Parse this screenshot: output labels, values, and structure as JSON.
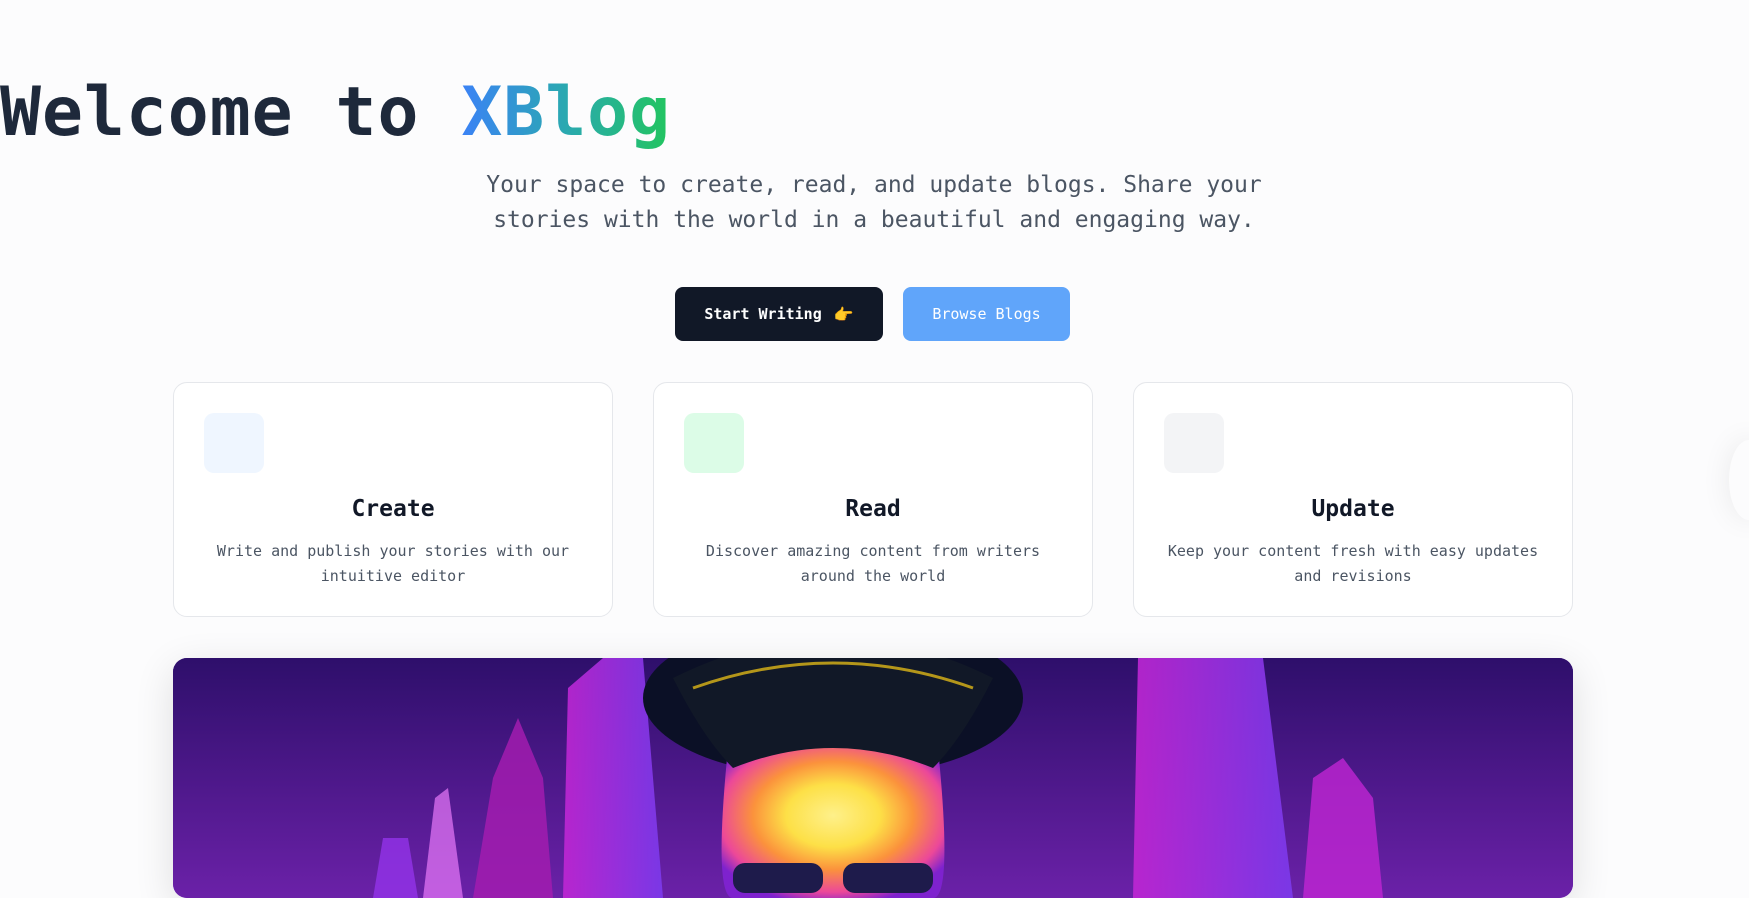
{
  "hero": {
    "title_prefix": "Welcome to ",
    "title_brand": "XBlog",
    "subtitle_line1": "Your space to create, read, and update blogs. Share your",
    "subtitle_line2": "stories with the world in a beautiful and engaging way."
  },
  "buttons": {
    "start_writing": "Start Writing",
    "start_writing_emoji": "👉",
    "browse_blogs": "Browse Blogs"
  },
  "features": [
    {
      "title": "Create",
      "desc_line1": "Write and publish your stories with our",
      "desc_line2": "intuitive editor",
      "icon": "create-icon",
      "tint": "#eff6ff"
    },
    {
      "title": "Read",
      "desc_line1": "Discover amazing content from writers",
      "desc_line2": "around the world",
      "icon": "read-icon",
      "tint": "#dcfce7"
    },
    {
      "title": "Update",
      "desc_line1": "Keep your content fresh with easy updates",
      "desc_line2": "and revisions",
      "icon": "update-icon",
      "tint": "#f3f4f6"
    }
  ],
  "colors": {
    "primary_button": "#111827",
    "secondary_button": "#60a5fa",
    "brand_gradient_start": "#3b82f6",
    "brand_gradient_end": "#22c55e"
  }
}
